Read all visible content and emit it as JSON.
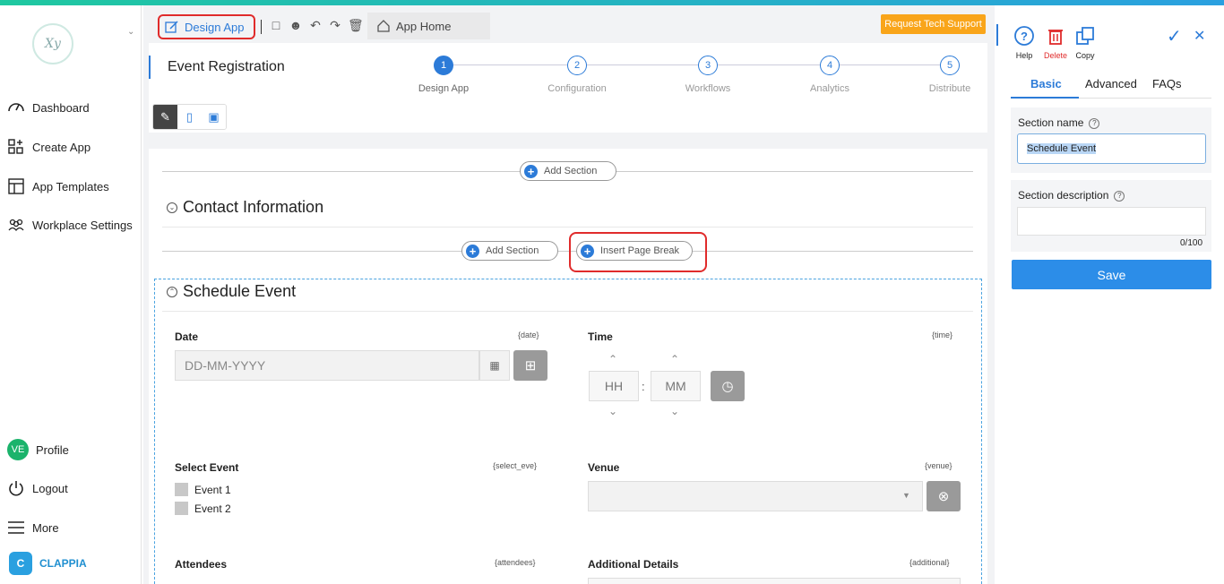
{
  "sidebar": {
    "logo_text": "Xy",
    "items": [
      {
        "label": "Dashboard",
        "icon": "speedometer-icon"
      },
      {
        "label": "Create App",
        "icon": "grid-plus-icon"
      },
      {
        "label": "App Templates",
        "icon": "template-icon"
      },
      {
        "label": "Workplace Settings",
        "icon": "users-icon"
      }
    ],
    "profile": {
      "initials": "VE",
      "label": "Profile"
    },
    "logout_label": "Logout",
    "more_label": "More",
    "brand": {
      "initial": "C",
      "name": "CLAPPIA"
    }
  },
  "toolbar": {
    "design_app_label": "Design App",
    "app_home_label": "App Home",
    "tech_support_label": "Request Tech Support"
  },
  "header": {
    "app_name": "Event Registration",
    "steps": [
      {
        "num": "1",
        "label": "Design App",
        "active": true
      },
      {
        "num": "2",
        "label": "Configuration"
      },
      {
        "num": "3",
        "label": "Workflows"
      },
      {
        "num": "4",
        "label": "Analytics"
      },
      {
        "num": "5",
        "label": "Distribute"
      }
    ]
  },
  "canvas": {
    "add_section_label": "Add Section",
    "insert_page_break_label": "Insert Page Break",
    "contact_section_title": "Contact Information",
    "schedule_section_title": "Schedule Event",
    "fields": {
      "date": {
        "label": "Date",
        "tag": "{date}",
        "placeholder": "DD-MM-YYYY"
      },
      "time": {
        "label": "Time",
        "tag": "{time}",
        "hh": "HH",
        "mm": "MM",
        "colon": ":"
      },
      "select_event": {
        "label": "Select Event",
        "tag": "{select_eve}",
        "options": [
          "Event 1",
          "Event 2"
        ]
      },
      "venue": {
        "label": "Venue",
        "tag": "{venue}"
      },
      "attendees": {
        "label": "Attendees",
        "tag": "{attendees}"
      },
      "additional": {
        "label": "Additional Details",
        "tag": "{additional}"
      }
    }
  },
  "right_panel": {
    "tools": [
      {
        "label": "Help",
        "color": "#2c7bd8"
      },
      {
        "label": "Delete",
        "color": "#e02b2b"
      },
      {
        "label": "Copy",
        "color": "#2c7bd8"
      }
    ],
    "tabs": [
      "Basic",
      "Advanced",
      "FAQs"
    ],
    "section_name_label": "Section name",
    "section_name_value": "Schedule Event",
    "section_description_label": "Section description",
    "char_count": "0/100",
    "save_label": "Save"
  }
}
